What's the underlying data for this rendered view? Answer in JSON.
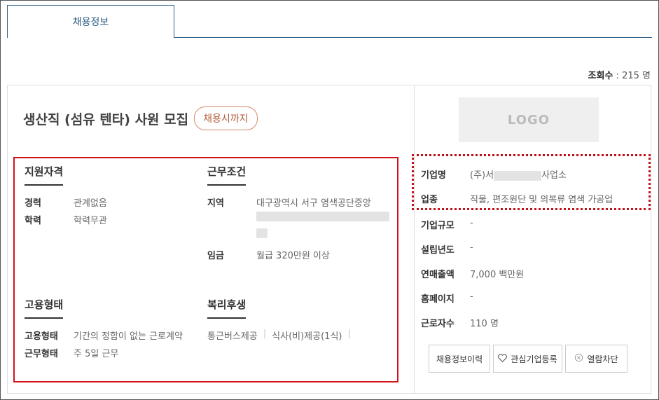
{
  "tabs": [
    {
      "label": "채용정보"
    }
  ],
  "views": {
    "label": "조회수",
    "value": ": 215 명"
  },
  "job": {
    "title": "생산직 (섬유 텐타) 사원 모집",
    "deadline_badge": "채용시까지"
  },
  "sections": {
    "qualification": {
      "title": "지원자격",
      "rows": [
        {
          "key": "경력",
          "value": "관계없음"
        },
        {
          "key": "학력",
          "value": "학력무관"
        }
      ]
    },
    "conditions": {
      "title": "근무조건",
      "region_key": "지역",
      "region_value": "대구광역시 서구 염색공단중앙",
      "wage_key": "임금",
      "wage_value": "월급 320만원 이상"
    },
    "employment": {
      "title": "고용형태",
      "rows": [
        {
          "key": "고용형태",
          "value": "기간의 정함이 없는 근로계약"
        },
        {
          "key": "근무형태",
          "value": "주 5일 근무"
        }
      ]
    },
    "benefits": {
      "title": "복리후생",
      "items": [
        "통근버스제공",
        "식사(비)제공(1식)"
      ],
      "separator": "|"
    }
  },
  "company": {
    "logo_text": "LOGO",
    "rows": [
      {
        "key": "기업명",
        "value_prefix": "(주)서",
        "value_suffix": "사업소"
      },
      {
        "key": "업종",
        "value": "직물, 편조원단 및 의복류 염색 가공업"
      },
      {
        "key": "기업규모",
        "value": "-"
      },
      {
        "key": "설립년도",
        "value": "-"
      },
      {
        "key": "연매출액",
        "value": "7,000 백만원"
      },
      {
        "key": "홈페이지",
        "value": "-"
      },
      {
        "key": "근로자수",
        "value": "110 명"
      }
    ]
  },
  "buttons": {
    "history": "채용정보이력",
    "favorite": "관심기업등록",
    "block": "열람차단"
  },
  "icons": {
    "favorite": "heart-icon",
    "block": "close-circle-icon"
  },
  "colors": {
    "tab_border": "#2b5f86",
    "red_box": "#d2121b",
    "badge": "#b25a3a"
  }
}
